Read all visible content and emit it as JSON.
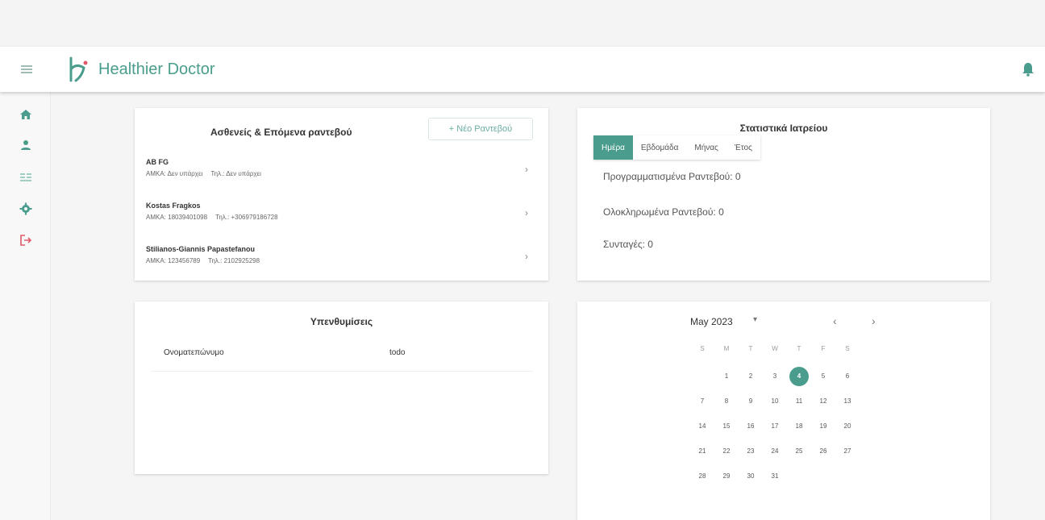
{
  "app": {
    "brand": "Healthier Doctor"
  },
  "icons": {
    "menu": "hamburger-icon",
    "logo": "brand-logo",
    "bell": "bell-icon",
    "nav": [
      "home-icon",
      "person-icon",
      "list-icon",
      "gear-icon",
      "logout-icon"
    ],
    "chevron": "chevron-right-icon"
  },
  "colors": {
    "accent": "#4a9d8d",
    "logout": "#e05a6a"
  },
  "patients_card": {
    "title": "Ασθενείς & Επόμενα ραντεβού",
    "new_button": "+  Νέο Ραντεβού",
    "patients": [
      {
        "name": "AB FG",
        "amka": "ΑΜΚΑ: Δεν υπάρχει",
        "phone": "Τηλ.: Δεν υπάρχει"
      },
      {
        "name": "Kostas Fragkos",
        "amka": "ΑΜΚΑ: 18039401098",
        "phone": "Τηλ.: +306979186728"
      },
      {
        "name": "Stilianos-Giannis Papastefanou",
        "amka": "ΑΜΚΑ: 123456789",
        "phone": "Τηλ.: 2102925298"
      }
    ]
  },
  "stats_card": {
    "title": "Στατιστικά Ιατρείου",
    "tabs": [
      "Ημέρα",
      "Εβδομάδα",
      "Μήνας",
      "Έτος"
    ],
    "active_tab": "Ημέρα",
    "stats": [
      {
        "label": "Προγραμματισμένα Ραντεβού: 0"
      },
      {
        "label": "Ολοκληρωμένα Ραντεβού: 0"
      },
      {
        "label": "Συνταγές: 0"
      }
    ]
  },
  "reminders_card": {
    "title": "Υπενθυμίσεις",
    "columns": [
      "Ονοματεπώνυμο",
      "todo"
    ]
  },
  "calendar": {
    "month_label": "May 2023",
    "caret": "▾",
    "prev": "‹",
    "next": "›",
    "weekdays": [
      "S",
      "M",
      "T",
      "W",
      "T",
      "F",
      "S"
    ],
    "first_weekday_index": 1,
    "days_in_month": 31,
    "selected_day": 4
  }
}
